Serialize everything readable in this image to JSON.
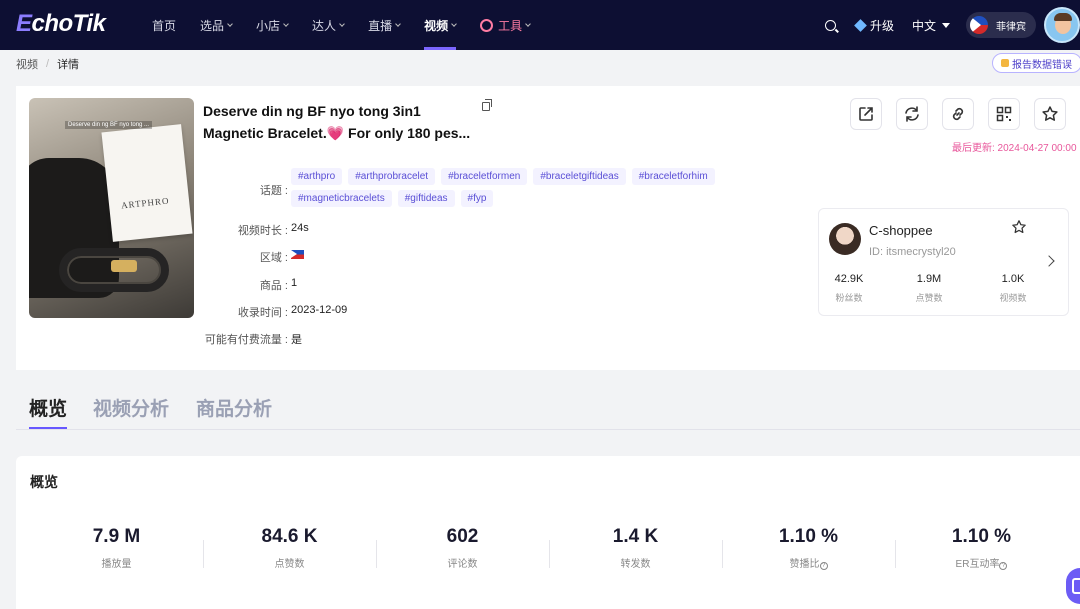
{
  "nav": {
    "logo_first": "E",
    "logo_rest": "choTik",
    "items": [
      {
        "label": "首页",
        "dropdown": false
      },
      {
        "label": "选品",
        "dropdown": true
      },
      {
        "label": "小店",
        "dropdown": true
      },
      {
        "label": "达人",
        "dropdown": true
      },
      {
        "label": "直播",
        "dropdown": true
      },
      {
        "label": "视频",
        "dropdown": true,
        "active": true
      }
    ],
    "tools_label": "工具",
    "upgrade_label": "升级",
    "language_label": "中文",
    "region_label": "菲律宾"
  },
  "breadcrumb": {
    "parent": "视频",
    "separator": "/",
    "current": "详情"
  },
  "report_button": "报告数据错误",
  "video": {
    "title": "Deserve din ng BF nyo tong 3in1 Magnetic Bracelet.💗 For only 180 pes...",
    "thumbnail_caption": "Deserve din ng BF nyo tong ...",
    "thumbnail_brand": "ARTPHRO",
    "fields": {
      "topics_label": "话题 :",
      "duration_label": "视频时长 :",
      "duration_value": "24s",
      "region_label": "区域 :",
      "products_label": "商品 :",
      "products_value": "1",
      "collected_label": "收录时间 :",
      "collected_value": "2023-12-09",
      "paid_label": "可能有付费流量 :",
      "paid_value": "是"
    },
    "tags": [
      "#arthpro",
      "#arthprobracelet",
      "#braceletformen",
      "#braceletgiftideas",
      "#braceletforhim",
      "#magneticbracelets",
      "#giftideas",
      "#fyp"
    ],
    "last_updated": "最后更新: 2024-04-27 00:00"
  },
  "actions": [
    "open-link-icon",
    "refresh-icon",
    "link-icon",
    "qrcode-icon",
    "star-icon"
  ],
  "creator": {
    "name": "C-shoppee",
    "id": "ID: itsmecrystyl20",
    "stats": [
      {
        "value": "42.9K",
        "label": "粉丝数"
      },
      {
        "value": "1.9M",
        "label": "点赞数"
      },
      {
        "value": "1.0K",
        "label": "视频数"
      }
    ]
  },
  "tabs": [
    "概览",
    "视频分析",
    "商品分析"
  ],
  "overview": {
    "title": "概览",
    "stats": [
      {
        "value": "7.9 M",
        "label": "播放量"
      },
      {
        "value": "84.6 K",
        "label": "点赞数"
      },
      {
        "value": "602",
        "label": "评论数"
      },
      {
        "value": "1.4 K",
        "label": "转发数"
      },
      {
        "value": "1.10 %",
        "label": "赞播比"
      },
      {
        "value": "1.10 %",
        "label": "ER互动率"
      }
    ]
  },
  "colors": {
    "nav_bg": "#0d0f33",
    "accent": "#6657ff",
    "tag_text": "#5a4fd6",
    "updated_text": "#e8579b"
  }
}
